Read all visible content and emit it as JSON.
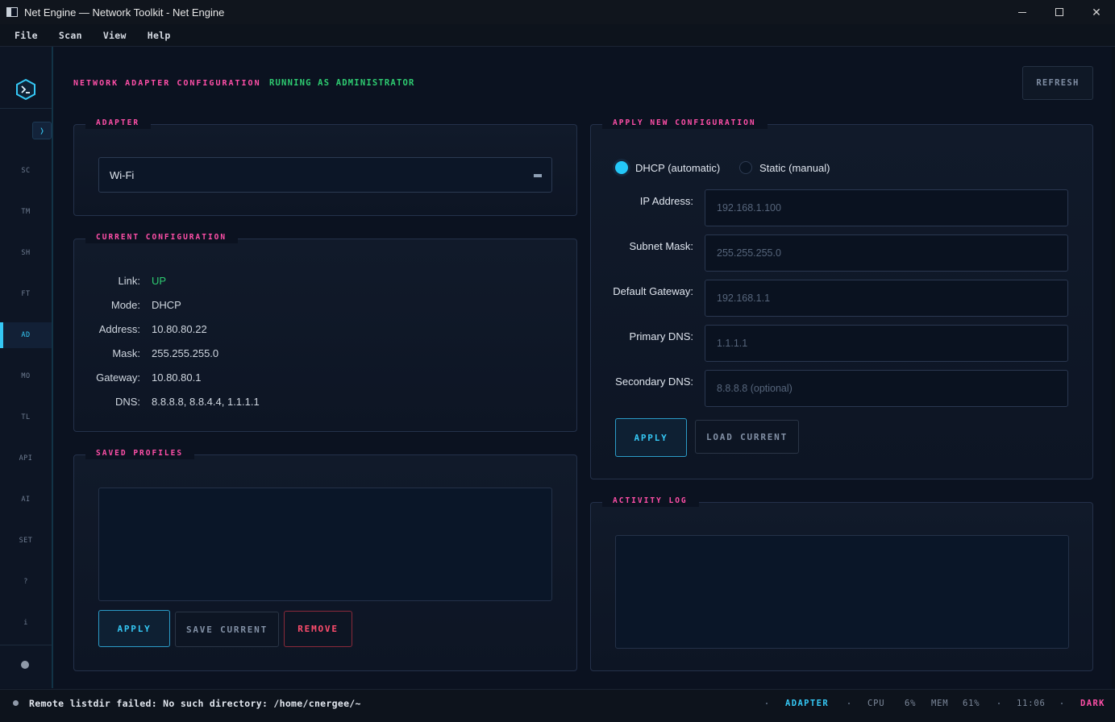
{
  "window": {
    "title": "Net Engine — Network Toolkit - Net Engine"
  },
  "menu": [
    "File",
    "Scan",
    "View",
    "Help"
  ],
  "sidebar": {
    "collapse_label": "❭",
    "items": [
      "SC",
      "TM",
      "SH",
      "FT",
      "AD",
      "MO",
      "TL",
      "API",
      "AI",
      "SET",
      "?",
      "i"
    ],
    "active": "AD"
  },
  "header": {
    "title": "NETWORK ADAPTER CONFIGURATION",
    "admin_status": "RUNNING AS ADMINISTRATOR",
    "refresh_label": "REFRESH"
  },
  "adapter": {
    "section_label": "ADAPTER",
    "selected": "Wi-Fi"
  },
  "current_config": {
    "section_label": "CURRENT CONFIGURATION",
    "rows": [
      {
        "key": "Link:",
        "value": "UP"
      },
      {
        "key": "Mode:",
        "value": "DHCP"
      },
      {
        "key": "Address:",
        "value": "10.80.80.22"
      },
      {
        "key": "Mask:",
        "value": "255.255.255.0"
      },
      {
        "key": "Gateway:",
        "value": "10.80.80.1"
      },
      {
        "key": "DNS:",
        "value": "8.8.8.8, 8.8.4.4, 1.1.1.1"
      }
    ]
  },
  "saved_profiles": {
    "section_label": "SAVED PROFILES",
    "apply_label": "APPLY",
    "save_label": "SAVE CURRENT",
    "remove_label": "REMOVE"
  },
  "new_config": {
    "section_label": "APPLY NEW CONFIGURATION",
    "mode_dhcp": "DHCP (automatic)",
    "mode_static": "Static (manual)",
    "selected_mode": "DHCP",
    "fields": [
      {
        "label": "IP Address:",
        "placeholder": "192.168.1.100"
      },
      {
        "label": "Subnet Mask:",
        "placeholder": "255.255.255.0"
      },
      {
        "label": "Default Gateway:",
        "placeholder": "192.168.1.1"
      },
      {
        "label": "Primary DNS:",
        "placeholder": "1.1.1.1"
      },
      {
        "label": "Secondary DNS:",
        "placeholder": "8.8.8.8 (optional)"
      }
    ],
    "apply_label": "APPLY",
    "load_label": "LOAD CURRENT"
  },
  "activity_log": {
    "section_label": "ACTIVITY LOG"
  },
  "statusbar": {
    "message": "Remote listdir failed: No such directory: /home/cnergee/~",
    "page": "ADAPTER",
    "cpu_label": "CPU",
    "cpu_value": "6%",
    "mem_label": "MEM",
    "mem_value": "61%",
    "time": "11:06",
    "theme": "DARK"
  },
  "colors": {
    "accent": "#35c8f5",
    "pink": "#ff4fa8",
    "green": "#2ecc71",
    "danger": "#ff4d6d",
    "background": "#0b1220"
  }
}
